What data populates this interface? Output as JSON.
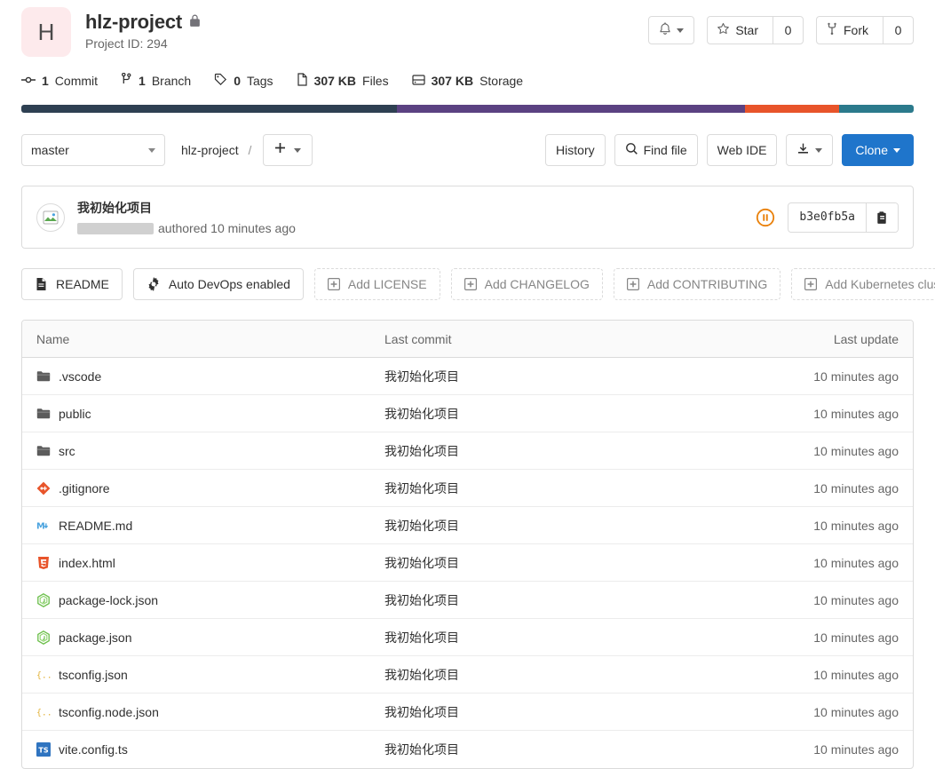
{
  "project": {
    "avatar_letter": "H",
    "name": "hlz-project",
    "visibility_icon": "lock-icon",
    "project_id_label": "Project ID: 294"
  },
  "header_actions": {
    "notifications_icon": "bell-icon",
    "star_label": "Star",
    "star_count": "0",
    "fork_label": "Fork",
    "fork_count": "0"
  },
  "stats": [
    {
      "icon": "commit-icon",
      "value": "1",
      "label": "Commit"
    },
    {
      "icon": "branch-icon",
      "value": "1",
      "label": "Branch"
    },
    {
      "icon": "tag-icon",
      "value": "0",
      "label": "Tags"
    },
    {
      "icon": "files-icon",
      "value": "307 KB",
      "label": "Files"
    },
    {
      "icon": "storage-icon",
      "value": "307 KB",
      "label": "Storage"
    }
  ],
  "language_bar": [
    {
      "color": "#2e4052",
      "percent": 42.1
    },
    {
      "color": "#5b4282",
      "percent": 39.0
    },
    {
      "color": "#e8542a",
      "percent": 10.5
    },
    {
      "color": "#2b7a8c",
      "percent": 8.4
    }
  ],
  "toolbar": {
    "branch": "master",
    "breadcrumb_root": "hlz-project",
    "breadcrumb_separator": "/",
    "add_icon": "plus-icon",
    "history_label": "History",
    "find_file_label": "Find file",
    "find_file_icon": "search-icon",
    "web_ide_label": "Web IDE",
    "download_icon": "download-icon",
    "clone_label": "Clone",
    "clone_color": "#1f75cb"
  },
  "commit": {
    "title": "我初始化项目",
    "author_redacted": true,
    "authored_text": "authored 10 minutes ago",
    "pipeline_status_icon": "pipeline-pending-icon",
    "pipeline_status_color": "#e9800a",
    "sha": "b3e0fb5a",
    "copy_icon": "copy-icon"
  },
  "quick_actions": [
    {
      "icon": "readme-icon",
      "label": "README",
      "style": "solid"
    },
    {
      "icon": "gear-icon",
      "label": "Auto DevOps enabled",
      "style": "solid"
    },
    {
      "icon": "plus-square-icon",
      "label": "Add LICENSE",
      "style": "dashed"
    },
    {
      "icon": "plus-square-icon",
      "label": "Add CHANGELOG",
      "style": "dashed"
    },
    {
      "icon": "plus-square-icon",
      "label": "Add CONTRIBUTING",
      "style": "dashed"
    },
    {
      "icon": "plus-square-icon",
      "label": "Add Kubernetes cluster",
      "style": "dashed"
    }
  ],
  "file_table": {
    "columns": {
      "name": "Name",
      "last_commit": "Last commit",
      "last_update": "Last update"
    },
    "rows": [
      {
        "icon": "folder-icon",
        "name": ".vscode",
        "last_commit": "我初始化项目",
        "last_update": "10 minutes ago"
      },
      {
        "icon": "folder-icon",
        "name": "public",
        "last_commit": "我初始化项目",
        "last_update": "10 minutes ago"
      },
      {
        "icon": "folder-icon",
        "name": "src",
        "last_commit": "我初始化项目",
        "last_update": "10 minutes ago"
      },
      {
        "icon": "git-icon",
        "name": ".gitignore",
        "last_commit": "我初始化项目",
        "last_update": "10 minutes ago"
      },
      {
        "icon": "markdown-icon",
        "name": "README.md",
        "last_commit": "我初始化项目",
        "last_update": "10 minutes ago"
      },
      {
        "icon": "html5-icon",
        "name": "index.html",
        "last_commit": "我初始化项目",
        "last_update": "10 minutes ago"
      },
      {
        "icon": "nodejs-icon",
        "name": "package-lock.json",
        "last_commit": "我初始化项目",
        "last_update": "10 minutes ago"
      },
      {
        "icon": "nodejs-icon",
        "name": "package.json",
        "last_commit": "我初始化项目",
        "last_update": "10 minutes ago"
      },
      {
        "icon": "json-icon",
        "name": "tsconfig.json",
        "last_commit": "我初始化项目",
        "last_update": "10 minutes ago"
      },
      {
        "icon": "json-icon",
        "name": "tsconfig.node.json",
        "last_commit": "我初始化项目",
        "last_update": "10 minutes ago"
      },
      {
        "icon": "typescript-icon",
        "name": "vite.config.ts",
        "last_commit": "我初始化项目",
        "last_update": "10 minutes ago"
      }
    ]
  }
}
